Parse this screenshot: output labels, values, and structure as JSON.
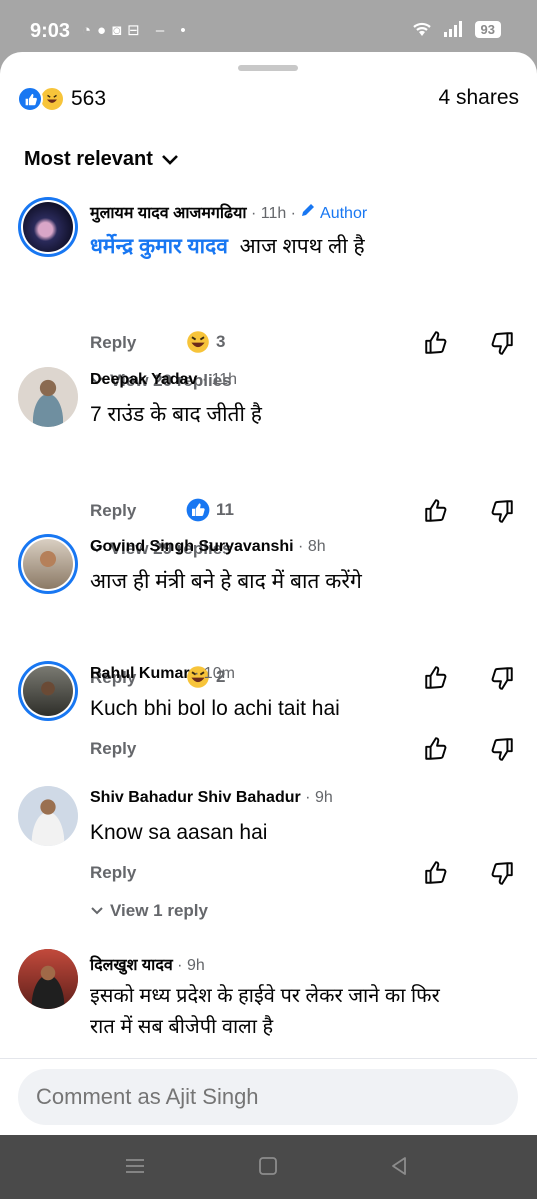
{
  "status": {
    "time": "9:03",
    "battery": "93"
  },
  "summary": {
    "reaction_count": "563",
    "shares": "4 shares"
  },
  "filter": {
    "label": "Most relevant"
  },
  "comments": [
    {
      "author": "मुलायम यादव आजमगढिया",
      "time": "· 11h ·",
      "author_tag": "Author",
      "mention": "धर्मेन्द्र कुमार यादव",
      "text": "आज शपथ ली है",
      "reply": "Reply",
      "reaction": "3",
      "view_replies": "View 20 replies"
    },
    {
      "author": "Deepak Yadav",
      "time": "· 11h",
      "text": "7 राउंड के बाद जीती है",
      "reply": "Reply",
      "reaction": "11",
      "view_replies": "View 29 replies"
    },
    {
      "author": "Govind Singh Suryavanshi",
      "time": "· 8h",
      "text": "आज ही मंत्री बने हे बाद में बात करेंगे",
      "reply": "Reply",
      "reaction": "2"
    },
    {
      "author": "Rahul Kumar",
      "time": "· 10m",
      "text": "Kuch bhi bol lo achi tait hai",
      "reply": "Reply"
    },
    {
      "author": "Shiv Bahadur Shiv Bahadur",
      "time": "· 9h",
      "text": "Know sa aasan hai",
      "reply": "Reply",
      "view_replies": "View 1 reply"
    },
    {
      "author": "दिलखुश यादव",
      "time": "· 9h",
      "text_line1": "इसको मध्य प्रदेश के हाईवे पर लेकर जाने का फिर",
      "text_line2": "रात में सब बीजेपी वाला है"
    }
  ],
  "composer": {
    "placeholder": "Comment as Ajit Singh"
  },
  "colors": {
    "accent": "#1877f2",
    "muted": "#65676b"
  }
}
